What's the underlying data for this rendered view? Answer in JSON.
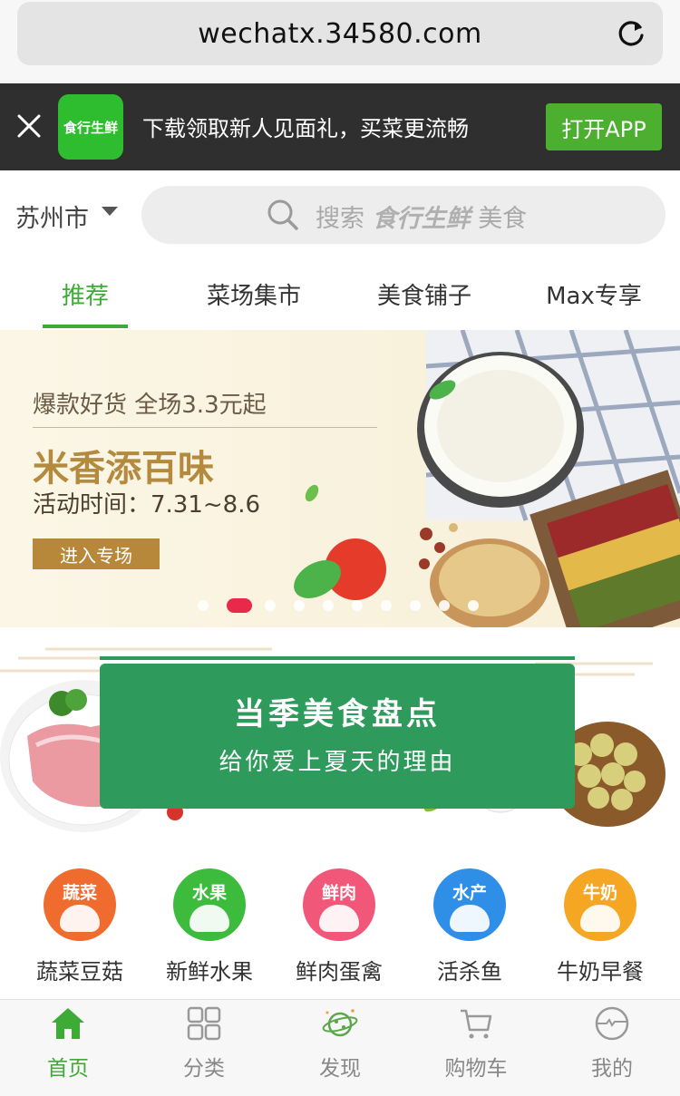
{
  "browser": {
    "url": "wechatx.34580.com"
  },
  "app_banner": {
    "logo_text": "食行生鲜",
    "message": "下载领取新人见面礼，买菜更流畅",
    "open_button": "打开APP"
  },
  "header": {
    "city": "苏州市",
    "search_prefix": "搜索",
    "search_brand": "食行生鲜",
    "search_suffix": "美食"
  },
  "tabs": [
    {
      "label": "推荐",
      "active": true
    },
    {
      "label": "菜场集市",
      "active": false
    },
    {
      "label": "美食铺子",
      "active": false
    },
    {
      "label": "Max专享",
      "active": false
    }
  ],
  "promo": {
    "subtitle": "爆款好货 全场3.3元起",
    "title": "米香添百味",
    "time": "活动时间：7.31~8.6",
    "button": "进入专场",
    "carousel_total": 10,
    "carousel_active": 2
  },
  "season": {
    "title": "当季美食盘点",
    "subtitle": "给你爱上夏天的理由"
  },
  "categories": [
    {
      "badge": "蔬菜",
      "label": "蔬菜豆菇",
      "color": "#f06b2e"
    },
    {
      "badge": "水果",
      "label": "新鲜水果",
      "color": "#3dbb3d"
    },
    {
      "badge": "鲜肉",
      "label": "鲜肉蛋禽",
      "color": "#f05779"
    },
    {
      "badge": "水产",
      "label": "活杀鱼",
      "color": "#2f8ee8"
    },
    {
      "badge": "牛奶",
      "label": "牛奶早餐",
      "color": "#f5a623"
    }
  ],
  "bottom_nav": [
    {
      "label": "首页",
      "icon": "home-icon",
      "active": true
    },
    {
      "label": "分类",
      "icon": "grid-icon",
      "active": false
    },
    {
      "label": "发现",
      "icon": "planet-icon",
      "active": false
    },
    {
      "label": "购物车",
      "icon": "cart-icon",
      "active": false
    },
    {
      "label": "我的",
      "icon": "profile-icon",
      "active": false
    }
  ],
  "colors": {
    "accent": "#3dab36",
    "promo_gold": "#b48a3e",
    "carousel_active": "#e8294a"
  }
}
